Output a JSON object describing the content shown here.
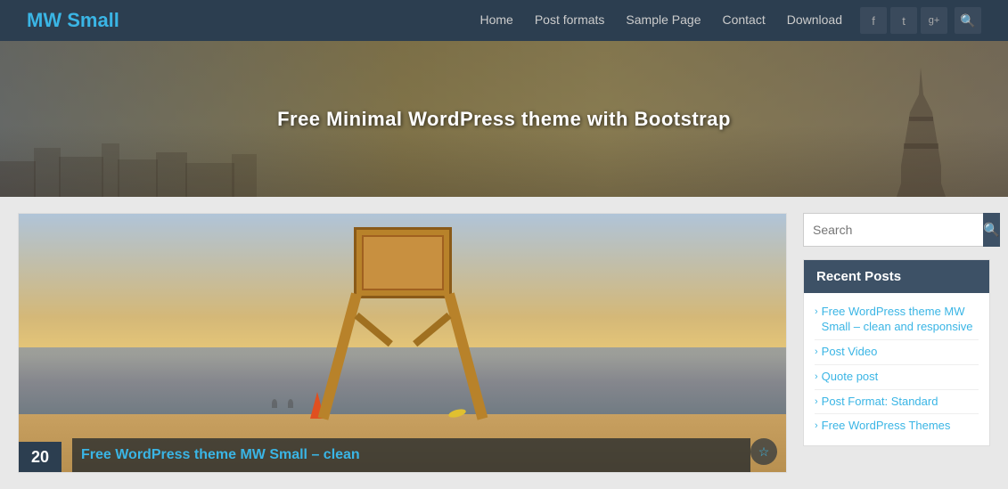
{
  "site": {
    "title": "MW Small"
  },
  "nav": {
    "items": [
      {
        "label": "Home",
        "href": "#"
      },
      {
        "label": "Post formats",
        "href": "#"
      },
      {
        "label": "Sample Page",
        "href": "#"
      },
      {
        "label": "Contact",
        "href": "#"
      },
      {
        "label": "Download",
        "href": "#"
      }
    ]
  },
  "social": [
    {
      "name": "facebook-icon",
      "char": "f"
    },
    {
      "name": "twitter-icon",
      "char": "t"
    },
    {
      "name": "googleplus-icon",
      "char": "g+"
    },
    {
      "name": "search-header-icon",
      "char": "🔍"
    }
  ],
  "hero": {
    "text": "Free Minimal WordPress theme with Bootstrap"
  },
  "post": {
    "date": "20",
    "title": "Free WordPress theme MW Small – clean",
    "title_full": "Free WordPress theme MW Small – clean and responsive",
    "image_alt": "Lifeguard tower on beach"
  },
  "sidebar": {
    "search_placeholder": "Search",
    "recent_posts_title": "Recent Posts",
    "recent_posts": [
      {
        "label": "Free WordPress theme MW Small – clean and responsive"
      },
      {
        "label": "Post Video"
      },
      {
        "label": "Quote post"
      },
      {
        "label": "Post Format: Standard"
      },
      {
        "label": "Free WordPress Themes"
      }
    ]
  }
}
